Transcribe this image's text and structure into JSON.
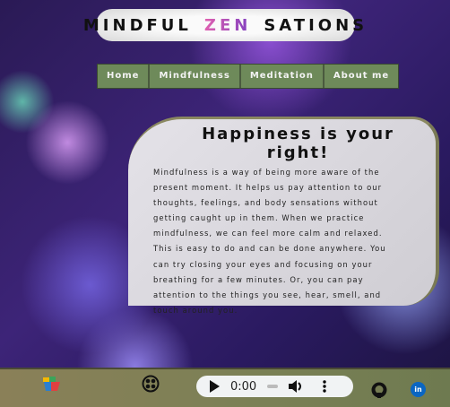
{
  "header": {
    "title_part1": "MINDFUL",
    "title_part2": "ZEN",
    "title_part3": "SATIONS"
  },
  "nav": {
    "items": [
      {
        "label": "Home"
      },
      {
        "label": "Mindfulness"
      },
      {
        "label": "Meditation"
      },
      {
        "label": "About me"
      }
    ]
  },
  "card": {
    "heading": "Happiness is your right!",
    "lines": [
      "Mindfulness is a way of being more aware of the",
      "present moment. It helps us pay attention to our",
      "thoughts, feelings, and body sensations without",
      "getting caught up in them. When we practice",
      "mindfulness, we can feel more calm and relaxed.",
      "This is easy to do and can be done anywhere. You",
      "can try closing your eyes and focusing on your",
      "breathing for a few minutes. Or, you can pay",
      "attention to the things you see, hear, smell, and",
      "touch around you."
    ]
  },
  "footer": {
    "audio": {
      "time": "0:00",
      "play_icon": "play-icon",
      "volume_icon": "volume-icon",
      "menu_icon": "more-vert-icon"
    },
    "linkedin_label": "in"
  }
}
